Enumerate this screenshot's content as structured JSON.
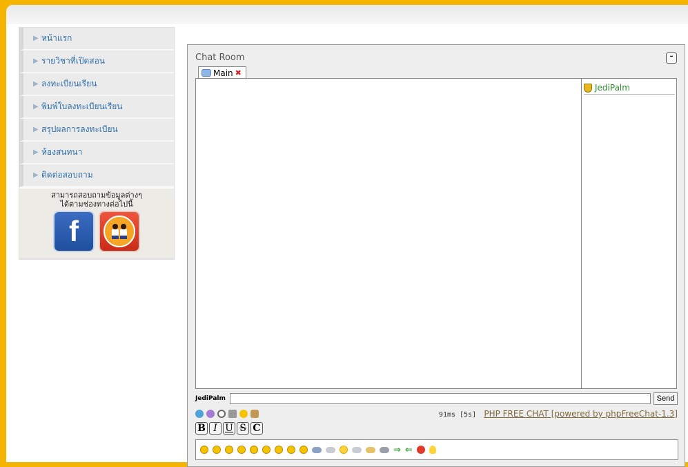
{
  "sidebar": {
    "items": [
      {
        "label": "หน้าแรก"
      },
      {
        "label": "รายวิชาที่เปิดสอน"
      },
      {
        "label": "ลงทะเบียนเรียน"
      },
      {
        "label": "พิมพ์ใบลงทะเบียนเรียน"
      },
      {
        "label": "สรุปผลการลงทะเบียน"
      },
      {
        "label": "ห้องสนทนา"
      },
      {
        "label": "ติดต่อสอบถาม"
      }
    ],
    "contact": {
      "line1": "สามารถสอบถามข้อมูลต่างๆ",
      "line2": "ได้ตามช่องทางต่อไปนี้",
      "facebook_letter": "f"
    }
  },
  "chat": {
    "title": "Chat Room",
    "minimize_symbol": "–",
    "tab": {
      "label": "Main",
      "close_symbol": "✖"
    },
    "users": [
      {
        "nick": "JediPalm"
      }
    ],
    "input": {
      "nick_label": "JediPalm",
      "value": "",
      "send_label": "Send"
    },
    "stats": {
      "timing": "91ms [5s]",
      "powered_by": "PHP FREE CHAT [powered by phpFreeChat-1.3]"
    },
    "format_buttons": {
      "bold": "B",
      "italic": "I",
      "underline": "U",
      "strike": "S",
      "color": "C"
    }
  },
  "colors": {
    "accent": "#f5b400",
    "menu_text": "#2f6fa6",
    "nick": "#2d8a2d"
  }
}
